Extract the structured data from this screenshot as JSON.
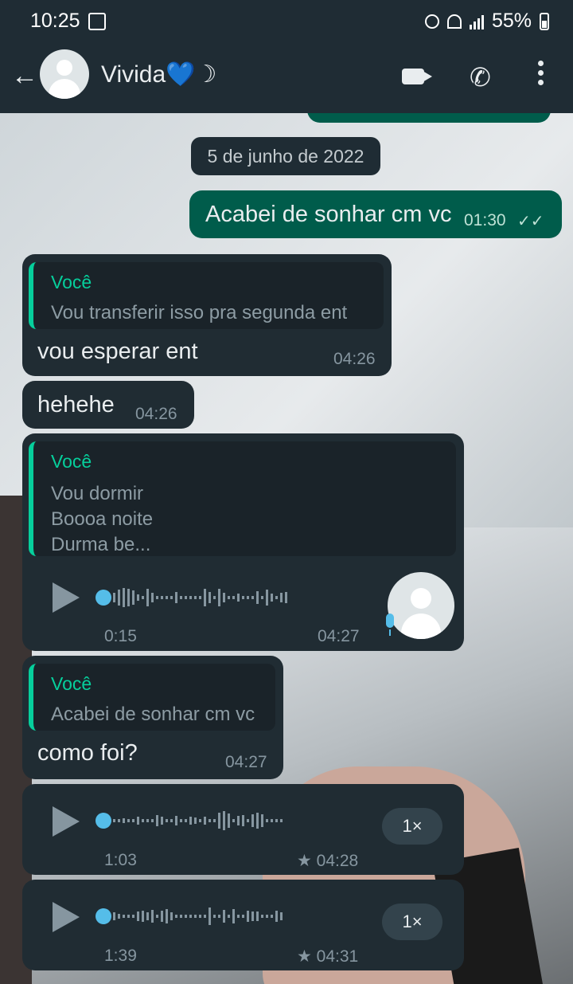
{
  "status_bar": {
    "time": "10:25",
    "battery": "55%"
  },
  "header": {
    "contact_name": "Vivida💙☽"
  },
  "chat": {
    "date_chip": "5 de junho de 2022",
    "messages": [
      {
        "type": "out",
        "text": "Acabei de sonhar cm vc",
        "time": "01:30",
        "ticks": "✓✓"
      },
      {
        "type": "in",
        "quote_author": "Você",
        "quote_text": "Vou transferir isso pra segunda ent",
        "text": "vou esperar ent",
        "time": "04:26"
      },
      {
        "type": "in",
        "text": "hehehe",
        "time": "04:26"
      },
      {
        "type": "in-voice",
        "quote_author": "Você",
        "quote_text": "Vou dormir\nBoooa noite\nDurma be...",
        "duration": "0:15",
        "time": "04:27"
      },
      {
        "type": "in",
        "quote_author": "Você",
        "quote_text": "Acabei de sonhar cm vc",
        "text": "como foi?",
        "time": "04:27"
      },
      {
        "type": "voice",
        "duration": "1:03",
        "time": "★ 04:28",
        "speed": "1×"
      },
      {
        "type": "voice",
        "duration": "1:39",
        "time": "★ 04:31",
        "speed": "1×"
      }
    ]
  },
  "colors": {
    "incoming": "#202c33",
    "outgoing": "#005c4b",
    "accent": "#06cf9c",
    "read_ticks": "#53bdeb"
  }
}
